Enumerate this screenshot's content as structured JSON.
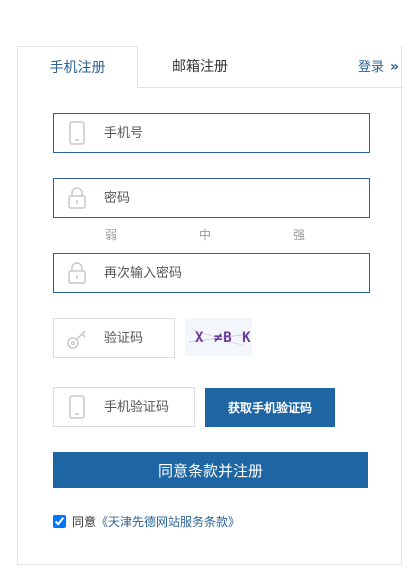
{
  "tabs": {
    "phone_register": "手机注册",
    "email_register": "邮箱注册"
  },
  "login_link": {
    "label": "登录",
    "chevron": "»"
  },
  "form": {
    "phone_placeholder": "手机号",
    "password_placeholder": "密码",
    "strength_levels": [
      "弱",
      "中",
      "强"
    ],
    "confirm_password_placeholder": "再次输入密码",
    "captcha_placeholder": "验证码",
    "captcha_text": "X ≠B K",
    "sms_code_placeholder": "手机验证码",
    "sms_button_label": "获取手机验证码",
    "submit_label": "同意条款并注册",
    "agree_prefix": "同意",
    "terms_link": "《天津先德网站服务条款》",
    "agree_checked": true
  },
  "colors": {
    "accent": "#1e65a3",
    "link": "#2c6396",
    "border": "#e3e3e3"
  }
}
